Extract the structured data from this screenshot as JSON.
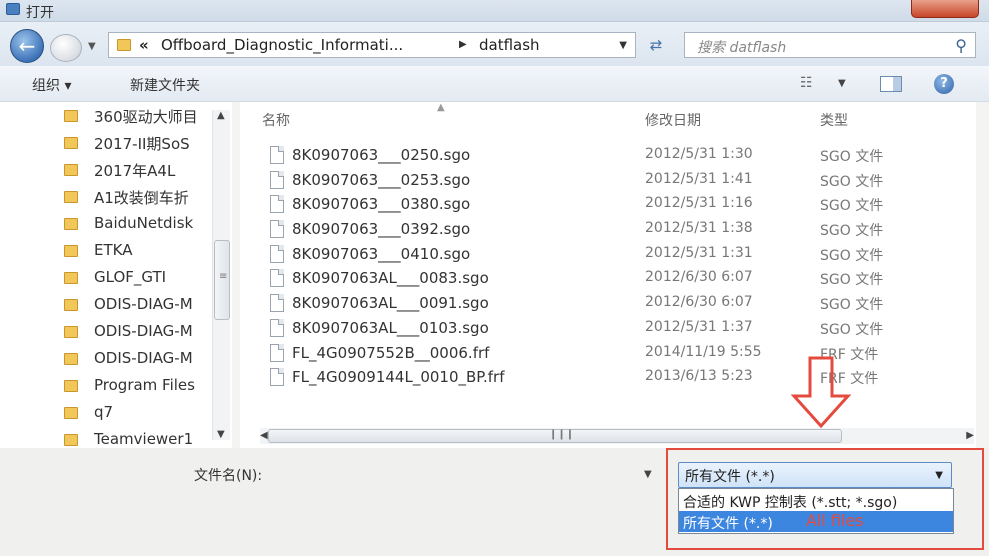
{
  "window": {
    "title": "打开"
  },
  "address_bar": {
    "chevrons": "«",
    "segment_1": "Offboard_Diagnostic_Informati...",
    "segment_2": "datflash"
  },
  "search": {
    "placeholder": "搜索 datflash"
  },
  "toolbar": {
    "organize": "组织 ▾",
    "new_folder": "新建文件夹"
  },
  "nav_tree": {
    "items": [
      {
        "label": "360驱动大师目"
      },
      {
        "label": "2017-II期SoS"
      },
      {
        "label": "2017年A4L"
      },
      {
        "label": "A1改装倒车折"
      },
      {
        "label": "BaiduNetdisk"
      },
      {
        "label": "ETKA"
      },
      {
        "label": "GLOF_GTI"
      },
      {
        "label": "ODIS-DIAG-M"
      },
      {
        "label": "ODIS-DIAG-M"
      },
      {
        "label": "ODIS-DIAG-M"
      },
      {
        "label": "Program Files"
      },
      {
        "label": "q7"
      },
      {
        "label": "Teamviewer1"
      }
    ]
  },
  "columns": {
    "name": "名称",
    "date": "修改日期",
    "type": "类型"
  },
  "files": [
    {
      "name": "8K0907063___0250.sgo",
      "date": "2012/5/31 1:30",
      "type": "SGO 文件"
    },
    {
      "name": "8K0907063___0253.sgo",
      "date": "2012/5/31 1:41",
      "type": "SGO 文件"
    },
    {
      "name": "8K0907063___0380.sgo",
      "date": "2012/5/31 1:16",
      "type": "SGO 文件"
    },
    {
      "name": "8K0907063___0392.sgo",
      "date": "2012/5/31 1:38",
      "type": "SGO 文件"
    },
    {
      "name": "8K0907063___0410.sgo",
      "date": "2012/5/31 1:31",
      "type": "SGO 文件"
    },
    {
      "name": "8K0907063AL___0083.sgo",
      "date": "2012/6/30 6:07",
      "type": "SGO 文件"
    },
    {
      "name": "8K0907063AL___0091.sgo",
      "date": "2012/6/30 6:07",
      "type": "SGO 文件"
    },
    {
      "name": "8K0907063AL___0103.sgo",
      "date": "2012/5/31 1:37",
      "type": "SGO 文件"
    },
    {
      "name": "FL_4G0907552B__0006.frf",
      "date": "2014/11/19 5:55",
      "type": "FRF 文件"
    },
    {
      "name": "FL_4G0909144L_0010_BP.frf",
      "date": "2013/6/13 5:23",
      "type": "FRF 文件"
    }
  ],
  "filename": {
    "label": "文件名(N):",
    "value": ""
  },
  "file_filter": {
    "selected": "所有文件 (*.*)",
    "options": [
      {
        "label": "合适的 KWP 控制表 (*.stt; *.sgo)"
      },
      {
        "label": "所有文件 (*.*)"
      }
    ]
  },
  "annotation": {
    "text": "All files",
    "color": "#e54a3f"
  }
}
